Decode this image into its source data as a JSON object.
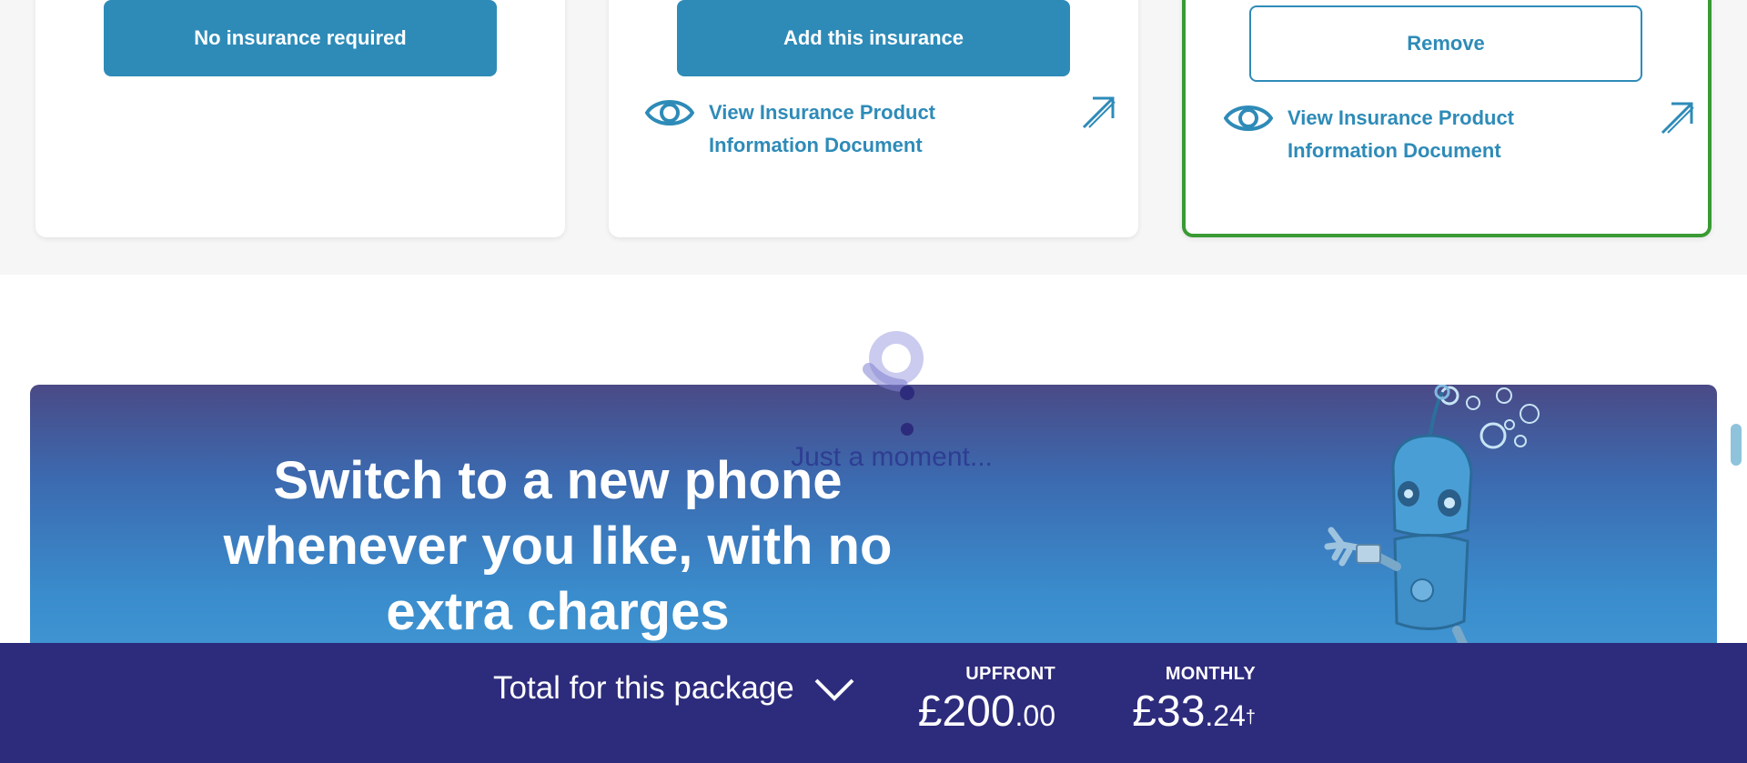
{
  "insurance_options": {
    "no_insurance": {
      "button_label": "No insurance required"
    },
    "option_2": {
      "button_label": "Add this insurance",
      "document_link": "View Insurance Product Information Document"
    },
    "option_3_selected": {
      "button_label": "Remove",
      "document_link": "View Insurance Product Information Document",
      "border_color": "#3a9a34"
    },
    "accent_color": "#2e8bb8",
    "icons": [
      "eye-icon",
      "external-link-arrow-icon"
    ]
  },
  "promo": {
    "headline": "Switch to a new phone whenever you like, with no extra charges"
  },
  "loader": {
    "text": "Just a moment..."
  },
  "footer": {
    "total_label": "Total for this package",
    "upfront": {
      "caption": "UPFRONT",
      "major": "£200",
      "minor": ".00"
    },
    "monthly": {
      "caption": "MONTHLY",
      "major": "£33",
      "minor": ".24",
      "marker": "†"
    },
    "background_color": "#2d2b7c"
  }
}
